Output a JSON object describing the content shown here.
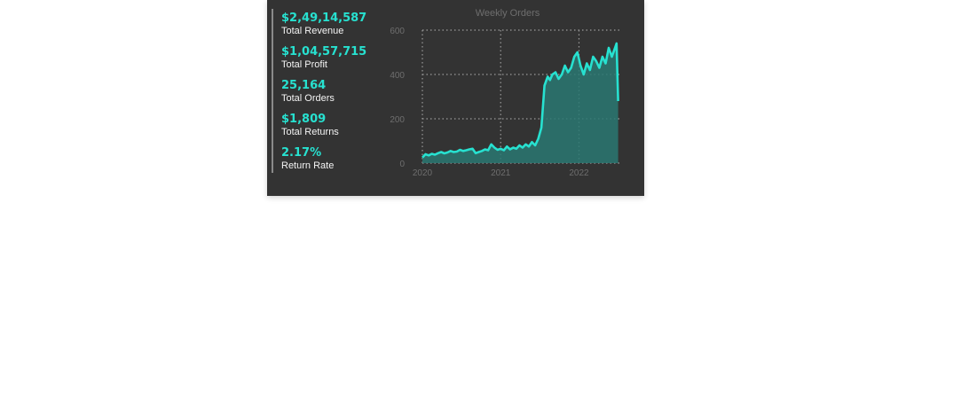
{
  "kpis": [
    {
      "value": "$2,49,14,587",
      "label": "Total Revenue"
    },
    {
      "value": "$1,04,57,715",
      "label": "Total Profit"
    },
    {
      "value": "25,164",
      "label": "Total Orders"
    },
    {
      "value": "$1,809",
      "label": "Total Returns"
    },
    {
      "value": "2.17%",
      "label": "Return Rate"
    }
  ],
  "colors": {
    "accent": "#27e1d0",
    "area_fill": "#2a7872",
    "panel_bg": "#333333",
    "axis_text": "#6e6e6e",
    "grid": "#9a9a9a"
  },
  "chart_data": {
    "type": "area",
    "title": "Weekly Orders",
    "xlabel": "",
    "ylabel": "",
    "x_tick_labels": [
      "2020",
      "2021",
      "2022"
    ],
    "y_tick_labels": [
      "0",
      "200",
      "400",
      "600"
    ],
    "ylim": [
      0,
      600
    ],
    "xlim": [
      2020.0,
      2022.55
    ],
    "grid": true,
    "series": [
      {
        "x": [
          2020.0,
          2020.04,
          2020.08,
          2020.12,
          2020.16,
          2020.2,
          2020.24,
          2020.28,
          2020.32,
          2020.36,
          2020.4,
          2020.44,
          2020.48,
          2020.52,
          2020.56,
          2020.6,
          2020.64,
          2020.68,
          2020.72,
          2020.76,
          2020.8,
          2020.84,
          2020.88,
          2020.92,
          2020.96,
          2021.0,
          2021.04,
          2021.08,
          2021.12,
          2021.16,
          2021.2,
          2021.24,
          2021.28,
          2021.32,
          2021.36,
          2021.4,
          2021.44,
          2021.48,
          2021.52,
          2021.56,
          2021.6,
          2021.63,
          2021.66,
          2021.7,
          2021.74,
          2021.78,
          2021.82,
          2021.86,
          2021.9,
          2021.94,
          2021.98,
          2022.02,
          2022.06,
          2022.1,
          2022.14,
          2022.18,
          2022.22,
          2022.26,
          2022.3,
          2022.34,
          2022.38,
          2022.42,
          2022.46,
          2022.48,
          2022.5
        ],
        "values": [
          25,
          40,
          35,
          42,
          38,
          45,
          50,
          44,
          48,
          55,
          50,
          52,
          60,
          55,
          58,
          62,
          65,
          45,
          50,
          55,
          62,
          58,
          85,
          70,
          60,
          65,
          58,
          75,
          62,
          70,
          65,
          80,
          70,
          85,
          75,
          95,
          80,
          110,
          160,
          350,
          390,
          375,
          400,
          410,
          380,
          400,
          440,
          410,
          430,
          480,
          500,
          440,
          400,
          450,
          420,
          480,
          460,
          430,
          480,
          450,
          520,
          480,
          520,
          540,
          280
        ]
      }
    ]
  }
}
